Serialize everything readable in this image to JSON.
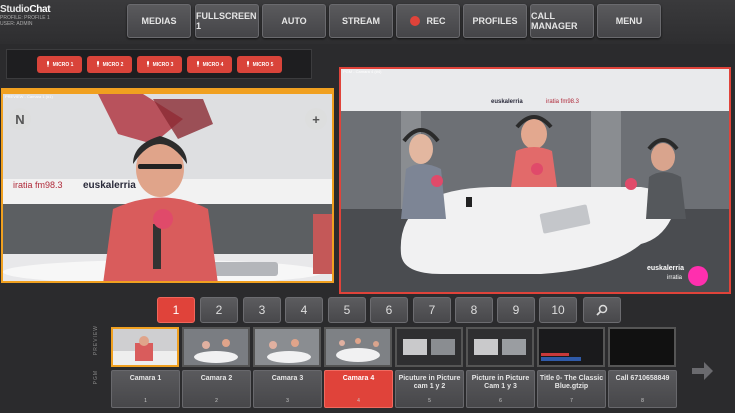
{
  "header": {
    "brand_prefix": "Studio",
    "brand_suffix": "Chat",
    "profile": "PROFILE: PROFILE 1",
    "user": "USER: ADMIN"
  },
  "toolbar": {
    "buttons": [
      "MEDIAS",
      "FULLSCREEN 1",
      "AUTO",
      "STREAM",
      "REC",
      "PROFILES",
      "CALL MANAGER",
      "MENU"
    ]
  },
  "mics": [
    "MICRO 1",
    "MICRO 2",
    "MICRO 3",
    "MICRO 4",
    "MICRO 5"
  ],
  "preview": {
    "label": "PREVIEW - Camara 1 (#1)",
    "sign_text": "euskalerria",
    "sign_accent": "iratia fm98.3"
  },
  "program": {
    "label": "PGM - Camara 4 (#4)",
    "banner_text": "euskalerria",
    "banner_accent": "iratia fm98.3",
    "watermark_main": "euskalerria",
    "watermark_sub": "irratia"
  },
  "numbers": [
    "1",
    "2",
    "3",
    "4",
    "5",
    "6",
    "7",
    "8",
    "9",
    "10"
  ],
  "active_number": "1",
  "rows": {
    "preview": "PREVIEW",
    "program": "PGM"
  },
  "sources": [
    {
      "label": "Camara 1",
      "num": "1"
    },
    {
      "label": "Camara 2",
      "num": "2"
    },
    {
      "label": "Camara 3",
      "num": "3"
    },
    {
      "label": "Camara 4",
      "num": "4"
    },
    {
      "label": "Picuture in Picture cam 1 y 2",
      "num": "5"
    },
    {
      "label": "Picture in Picture Cam 1 y 3",
      "num": "6"
    },
    {
      "label": "Title 0- The Classic Blue.gtzip",
      "num": "7"
    },
    {
      "label": "Call 6710658849",
      "num": "8"
    }
  ],
  "colors": {
    "accent_red": "#e0433a",
    "preview_orange": "#f0a020",
    "background": "#2b2b2d"
  }
}
